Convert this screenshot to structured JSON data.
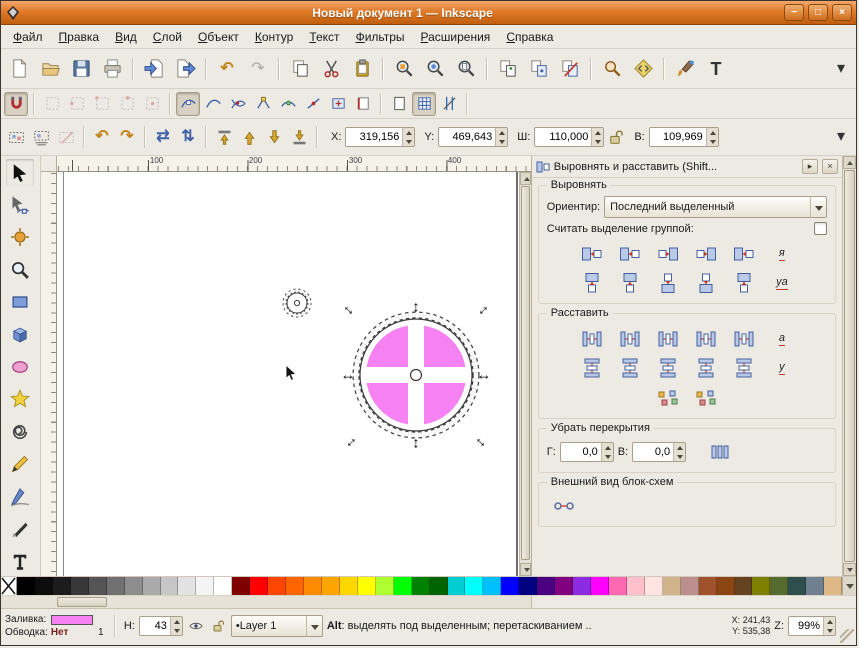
{
  "window": {
    "title": "Новый документ 1 — Inkscape"
  },
  "menu": {
    "items": [
      "Файл",
      "Правка",
      "Вид",
      "Слой",
      "Объект",
      "Контур",
      "Текст",
      "Фильтры",
      "Расширения",
      "Справка"
    ]
  },
  "tool_options": {
    "x_label": "X:",
    "x_value": "319,156",
    "y_label": "Y:",
    "y_value": "469,643",
    "width_label": "Ш:",
    "width_value": "110,000",
    "height_label": "В:",
    "height_value": "109,969"
  },
  "rulers": {
    "horizontal_labels": [
      "100",
      "200",
      "300",
      "400"
    ]
  },
  "align_panel": {
    "title": "Выровнять и расставить (Shift...",
    "align_section_label": "Выровнять",
    "anchor_label": "Ориентир:",
    "anchor_value": "Последний выделенный",
    "treat_as_group_label": "Считать выделение группой:",
    "align_buttons": [
      {
        "name": "align-right-edges-to-left-of-anchor",
        "icon": "pair",
        "rot": 0
      },
      {
        "name": "align-left-edges",
        "icon": "pair",
        "rot": 0
      },
      {
        "name": "center-on-vertical-axis",
        "icon": "pair",
        "rot": 180
      },
      {
        "name": "align-right-edges",
        "icon": "pair",
        "rot": 180
      },
      {
        "name": "align-left-edges-to-right-of-anchor",
        "icon": "pair",
        "rot": 0
      },
      {
        "name": "text-anchor-horizontal",
        "glyph": "я"
      },
      {
        "name": "align-bottoms-to-top-of-anchor",
        "icon": "pair",
        "rot": 90
      },
      {
        "name": "align-tops",
        "icon": "pair",
        "rot": 90
      },
      {
        "name": "center-on-horizontal-axis",
        "icon": "pair",
        "rot": 270
      },
      {
        "name": "align-bottoms",
        "icon": "pair",
        "rot": 270
      },
      {
        "name": "align-tops-to-bottom-of-anchor",
        "icon": "pair",
        "rot": 90
      },
      {
        "name": "align-text-baselines",
        "glyph": "уа"
      }
    ],
    "distribute_section_label": "Расставить",
    "distribute_buttons": [
      {
        "name": "distribute-left-edges",
        "icon": "bars",
        "rot": 0
      },
      {
        "name": "distribute-centers-horizontally",
        "icon": "bars",
        "rot": 0
      },
      {
        "name": "distribute-right-edges",
        "icon": "bars",
        "rot": 0
      },
      {
        "name": "make-horizontal-gaps-equal",
        "icon": "bars",
        "rot": 0
      },
      {
        "name": "distribute-horizontal-text-anchors",
        "icon": "bars",
        "rot": 0
      },
      {
        "name": "distribute-text-horizontally",
        "glyph": "а"
      },
      {
        "name": "distribute-top-edges",
        "icon": "bars",
        "rot": 90
      },
      {
        "name": "distribute-centers-vertically",
        "icon": "bars",
        "rot": 90
      },
      {
        "name": "distribute-bottom-edges",
        "icon": "bars",
        "rot": 90
      },
      {
        "name": "make-vertical-gaps-equal",
        "icon": "bars",
        "rot": 90
      },
      {
        "name": "distribute-vertical-text-anchors",
        "icon": "bars",
        "rot": 90
      },
      {
        "name": "distribute-text-vertically",
        "glyph": "у"
      }
    ],
    "extra_buttons": [
      {
        "name": "unclump-objects",
        "icon": "scatter"
      },
      {
        "name": "randomize-positions",
        "icon": "scatter"
      }
    ],
    "overlap_section_label": "Убрать перекрытия",
    "overlap_h_label": "Г:",
    "overlap_h_value": "0,0",
    "overlap_v_label": "В:",
    "overlap_v_value": "0,0",
    "connector_section_label": "Внешний вид блок-схем"
  },
  "palette": {
    "colors": [
      "#000000",
      "#0d0d0d",
      "#1c1c1c",
      "#383838",
      "#555555",
      "#717171",
      "#8d8d8d",
      "#aaaaaa",
      "#c6c6c6",
      "#e2e2e2",
      "#f4f4f4",
      "#ffffff",
      "#800000",
      "#ff0000",
      "#ff4500",
      "#ff6600",
      "#ff8c00",
      "#ffa500",
      "#ffd700",
      "#ffff00",
      "#adff2f",
      "#00ff00",
      "#008000",
      "#006400",
      "#00ced1",
      "#00ffff",
      "#00bfff",
      "#0000ff",
      "#000080",
      "#4b0082",
      "#800080",
      "#8a2be2",
      "#ff00ff",
      "#ff69b4",
      "#ffc0cb",
      "#ffe4e1",
      "#d2b48c",
      "#bc8f8f",
      "#a0522d",
      "#8b4513",
      "#654321",
      "#808000",
      "#556b2f",
      "#2f4f4f",
      "#708090",
      "#deb887"
    ]
  },
  "statusbar": {
    "fill_label": "Заливка:",
    "stroke_label": "Обводка:",
    "stroke_value": "Нет",
    "stroke_width": "1",
    "opacity_label": "Н:",
    "opacity_value": "43",
    "layer_name": "Layer 1",
    "message_bold": "Alt",
    "message_rest": ": выделять под выделенным; перетаскиванием ..",
    "x_label": "X:",
    "x_value": "241,43",
    "y_label": "Y:",
    "y_value": "535,38",
    "zoom_label": "Z:",
    "zoom_value": "99%"
  },
  "icons": {
    "undo": "↶",
    "redo": "↷",
    "rotate_ccw": "↶",
    "rotate_cw": "↷",
    "flip_horizontal": "⇄",
    "flip_vertical": "⇅",
    "chevron_down": "▾",
    "dock_float": "▸",
    "dock_close": "×",
    "window_minimize": "−",
    "window_maximize": "□",
    "window_close": "×",
    "text_dialog": "T",
    "handle_diagonal": "↔",
    "handle_horizontal": "↔",
    "handle_vertical": "↕",
    "layer_bullet": "•"
  },
  "colors": {
    "selection_fill": "#f581f3",
    "titlebar_orange": "#e07a28",
    "toolbar_bg": "#ede9e3"
  }
}
